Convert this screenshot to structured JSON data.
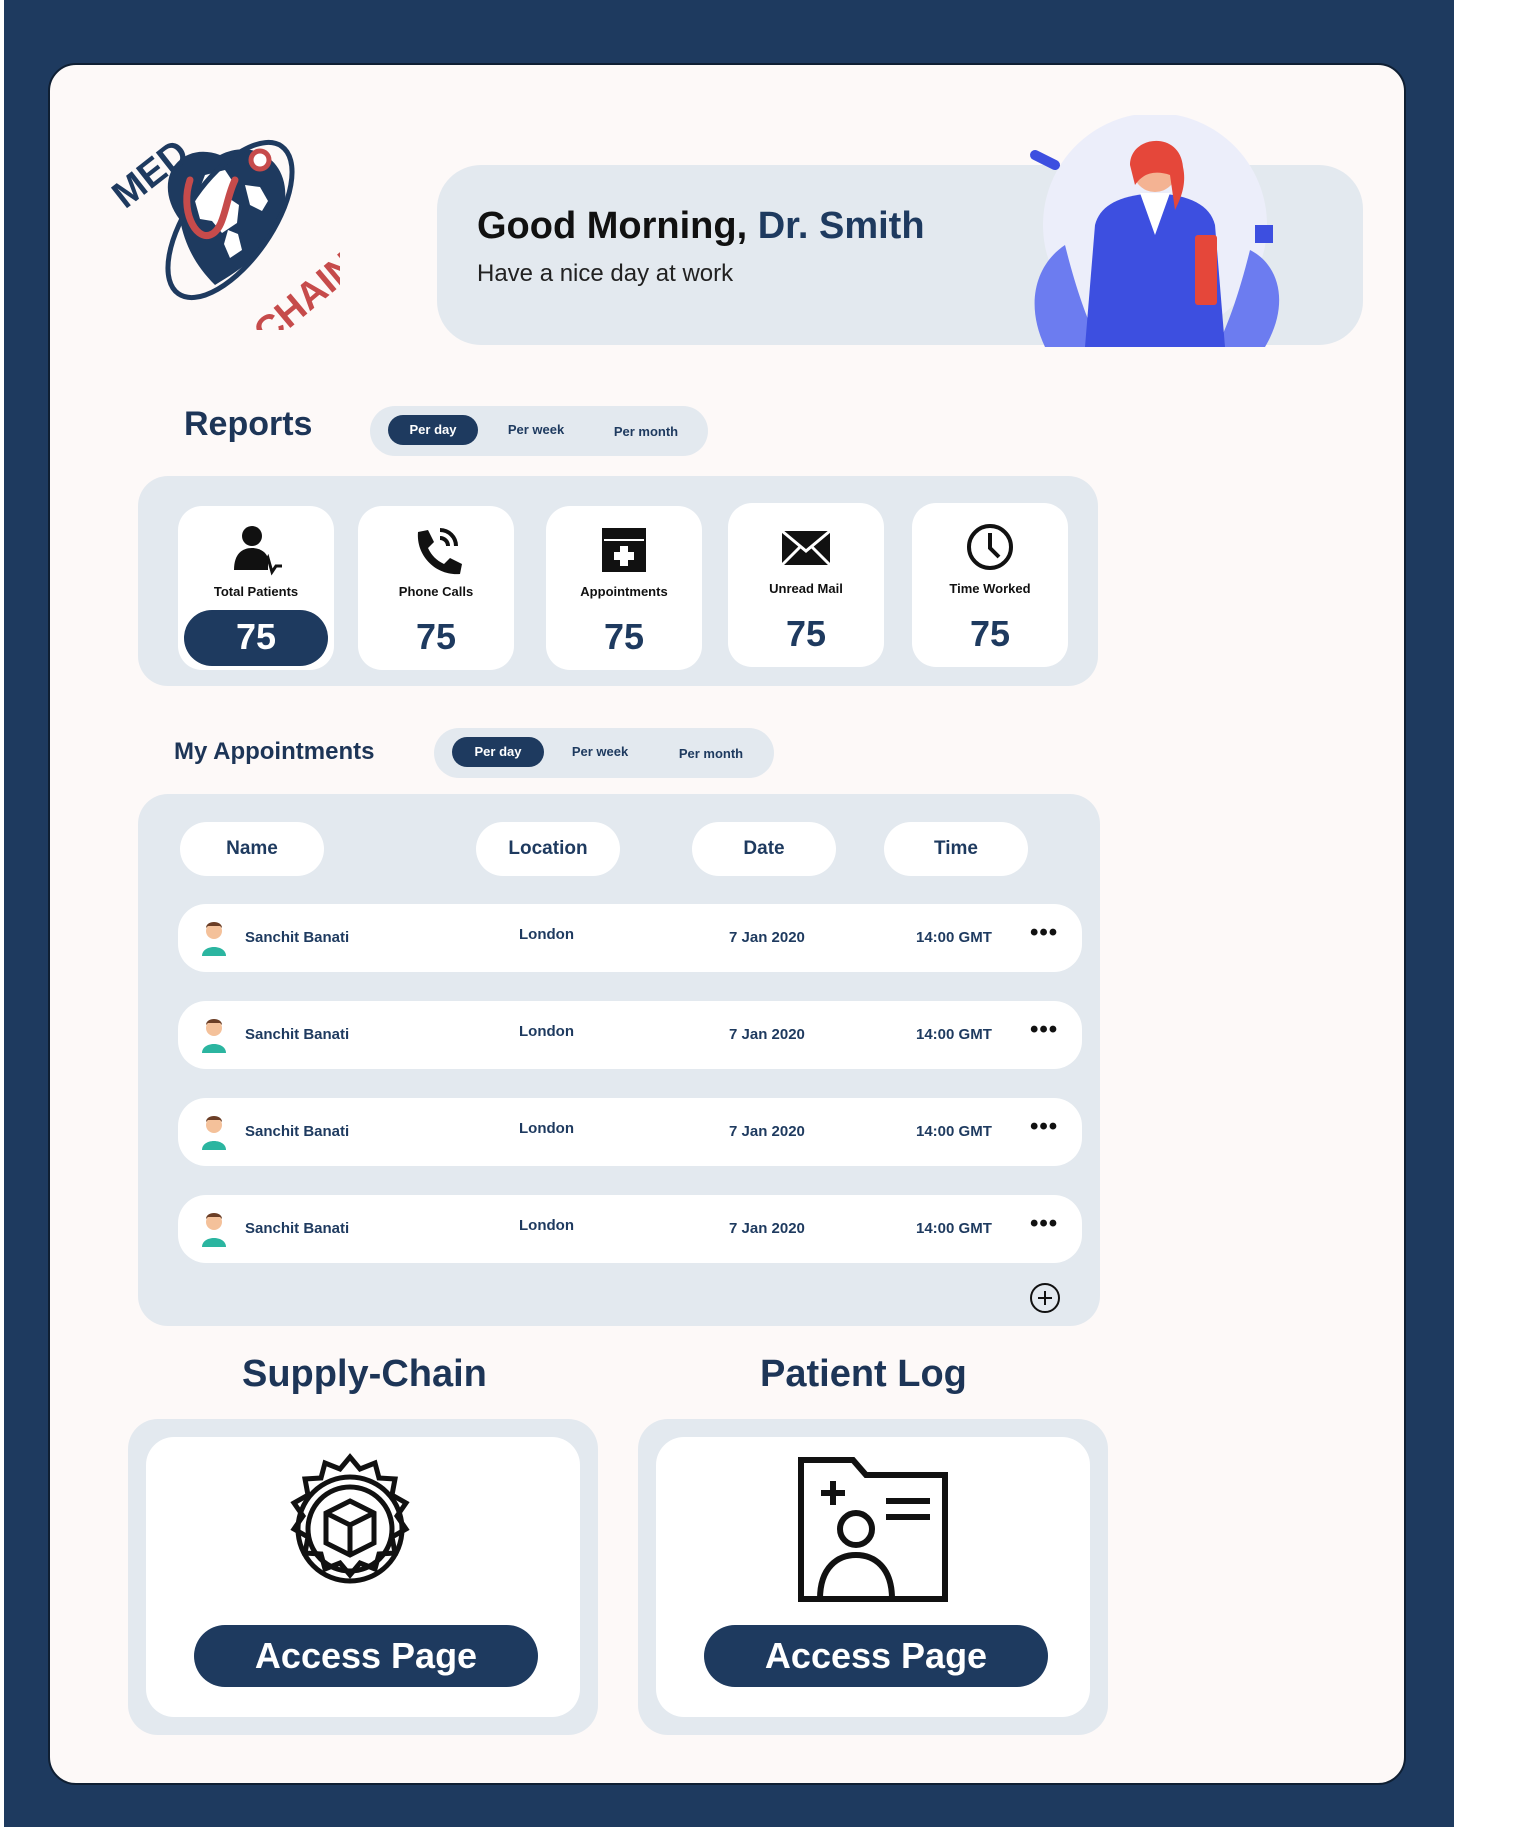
{
  "brand": {
    "logo_top": "MED",
    "logo_bottom": "CHAIN"
  },
  "greeting": {
    "prefix": "Good Morning,",
    "name": "Dr. Smith",
    "subtitle": "Have a nice day at work"
  },
  "reports": {
    "title": "Reports",
    "periods": [
      "Per day",
      "Per week",
      "Per month"
    ],
    "active_period": "Per day",
    "stats": [
      {
        "label": "Total Patients",
        "value": "75",
        "icon": "patient-icon"
      },
      {
        "label": "Phone Calls",
        "value": "75",
        "icon": "phone-icon"
      },
      {
        "label": "Appointments",
        "value": "75",
        "icon": "calendar-icon"
      },
      {
        "label": "Unread Mail",
        "value": "75",
        "icon": "mail-icon"
      },
      {
        "label": "Time Worked",
        "value": "75",
        "icon": "clock-icon"
      }
    ]
  },
  "appointments": {
    "title": "My Appointments",
    "periods": [
      "Per day",
      "Per week",
      "Per month"
    ],
    "active_period": "Per day",
    "columns": [
      "Name",
      "Location",
      "Date",
      "Time"
    ],
    "rows": [
      {
        "name": "Sanchit Banati",
        "location": "London",
        "date": "7 Jan 2020",
        "time": "14:00 GMT"
      },
      {
        "name": "Sanchit Banati",
        "location": "London",
        "date": "7 Jan 2020",
        "time": "14:00 GMT"
      },
      {
        "name": "Sanchit Banati",
        "location": "London",
        "date": "7 Jan 2020",
        "time": "14:00 GMT"
      },
      {
        "name": "Sanchit Banati",
        "location": "London",
        "date": "7 Jan 2020",
        "time": "14:00 GMT"
      }
    ],
    "more_label": "•••"
  },
  "supply_chain": {
    "title": "Supply-Chain",
    "button": "Access Page",
    "icon": "gear-box-icon"
  },
  "patient_log": {
    "title": "Patient Log",
    "button": "Access Page",
    "icon": "patient-file-icon"
  },
  "colors": {
    "navy": "#1e3a5f",
    "panel": "#e3e9ef",
    "background": "#fdf9f8",
    "accent_red": "#c64b4b"
  }
}
